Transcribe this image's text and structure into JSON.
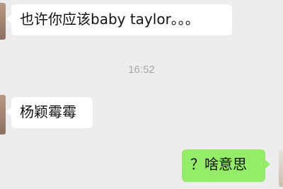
{
  "messages": [
    {
      "direction": "incoming",
      "text": "也许你应该baby taylor。。。"
    },
    {
      "direction": "incoming",
      "text": "杨颖霉霉"
    },
    {
      "direction": "outgoing",
      "text": "？啥意思"
    }
  ],
  "timestamp": "16:52",
  "colors": {
    "background": "#ededed",
    "incoming_bubble": "#ffffff",
    "outgoing_bubble": "#95ec69",
    "timestamp_text": "#a7a7a7"
  }
}
